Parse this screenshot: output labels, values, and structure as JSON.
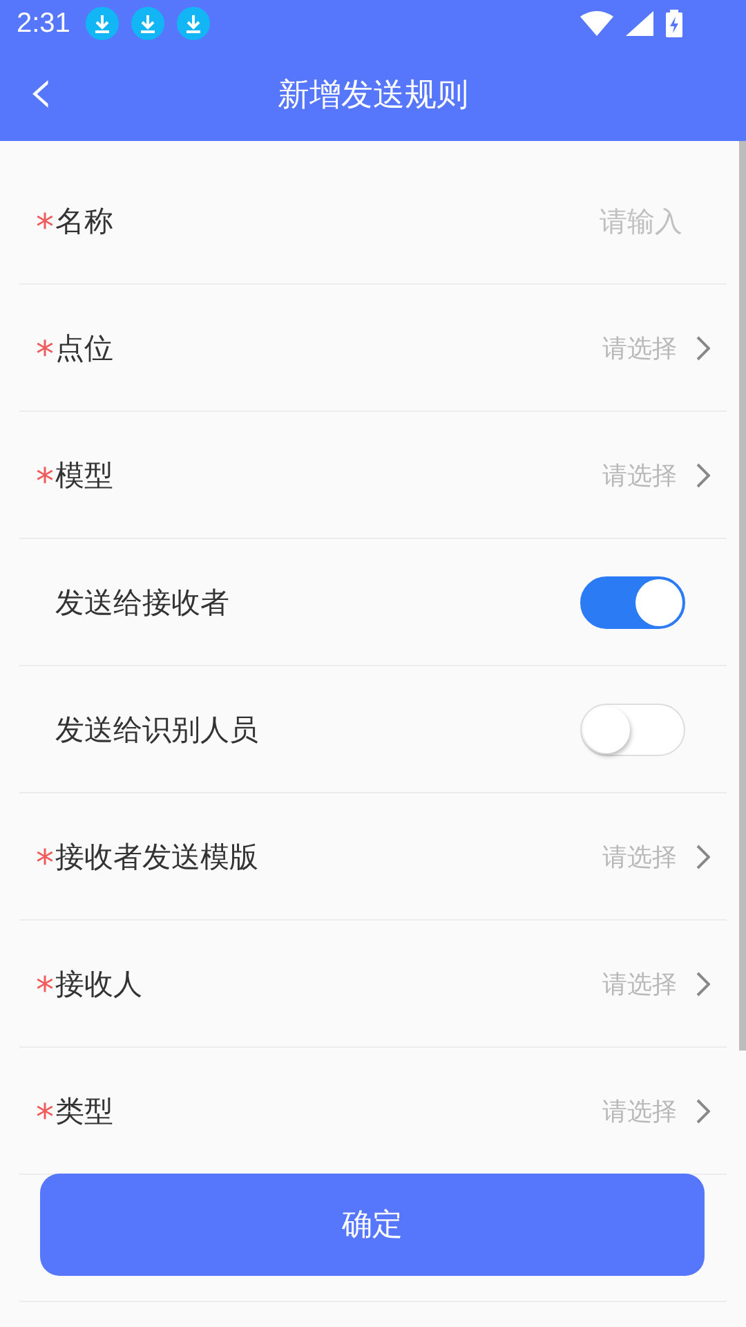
{
  "status_bar": {
    "time": "2:31",
    "notifications": [
      {
        "kind": "download"
      },
      {
        "kind": "download"
      },
      {
        "kind": "download"
      }
    ]
  },
  "header": {
    "back": "‹",
    "title": "新增发送规则"
  },
  "fields": [
    {
      "kind": "input",
      "required": true,
      "label": "名称",
      "placeholder": "请输入"
    },
    {
      "kind": "select",
      "required": true,
      "label": "点位",
      "placeholder": "请选择"
    },
    {
      "kind": "select",
      "required": true,
      "label": "模型",
      "placeholder": "请选择"
    },
    {
      "kind": "switch",
      "required": false,
      "label": "发送给接收者",
      "on": true
    },
    {
      "kind": "switch",
      "required": false,
      "label": "发送给识别人员",
      "on": false
    },
    {
      "kind": "select",
      "required": true,
      "label": "接收者发送模版",
      "placeholder": "请选择"
    },
    {
      "kind": "select",
      "required": true,
      "label": "接收人",
      "placeholder": "请选择"
    },
    {
      "kind": "select",
      "required": true,
      "label": "类型",
      "placeholder": "请选择"
    }
  ],
  "required_mark": "*",
  "confirm_button": "确定"
}
